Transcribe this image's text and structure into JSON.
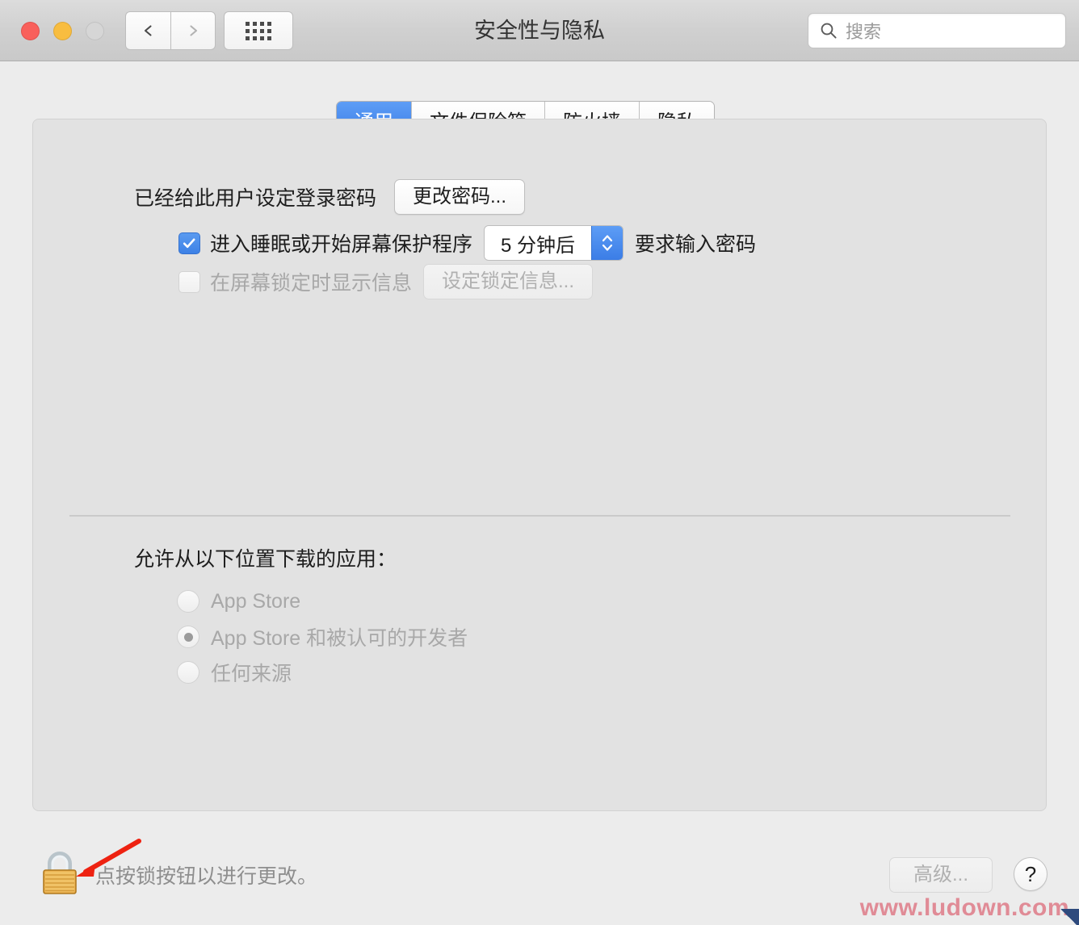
{
  "window": {
    "title": "安全性与隐私",
    "traffic_lights": [
      "close",
      "minimize",
      "zoom"
    ],
    "nav": {
      "back_icon": "chevron-left-icon",
      "forward_icon": "chevron-right-icon",
      "grid_icon": "grid-view-icon"
    }
  },
  "search": {
    "placeholder": "搜索",
    "icon": "search-icon"
  },
  "tabs": [
    {
      "label": "通用",
      "active": true
    },
    {
      "label": "文件保险箱",
      "active": false
    },
    {
      "label": "防火墙",
      "active": false
    },
    {
      "label": "隐私",
      "active": false
    }
  ],
  "general": {
    "password_status": "已经给此用户设定登录密码",
    "change_password_button": "更改密码...",
    "require_password": {
      "checkbox_checked": true,
      "label_before": "进入睡眠或开始屏幕保护程序",
      "stepper_value": "5 分钟后",
      "label_after": "要求输入密码"
    },
    "lock_message": {
      "checkbox_checked": false,
      "label": "在屏幕锁定时显示信息",
      "button": "设定锁定信息...",
      "disabled": true
    },
    "downloads": {
      "title": "允许从以下位置下载的应用：",
      "disabled": true,
      "options": [
        {
          "label": "App Store",
          "selected": false
        },
        {
          "label": "App Store 和被认可的开发者",
          "selected": true
        },
        {
          "label": "任何来源",
          "selected": false
        }
      ]
    }
  },
  "footer": {
    "lock_icon": "lock-closed-icon",
    "lock_caption": "点按锁按钮以进行更改。",
    "advanced_button": "高级...",
    "help_button": "?",
    "annotation_arrow": "red-arrow-icon"
  },
  "watermark": {
    "text": "www.ludown.com"
  },
  "colors": {
    "accent_blue": "#3b7de6",
    "window_bg": "#ececec",
    "panel_bg": "#e2e2e2",
    "disabled_text": "#a8a8a8",
    "watermark": "#e08b96",
    "annotation_red": "#ee2211"
  }
}
